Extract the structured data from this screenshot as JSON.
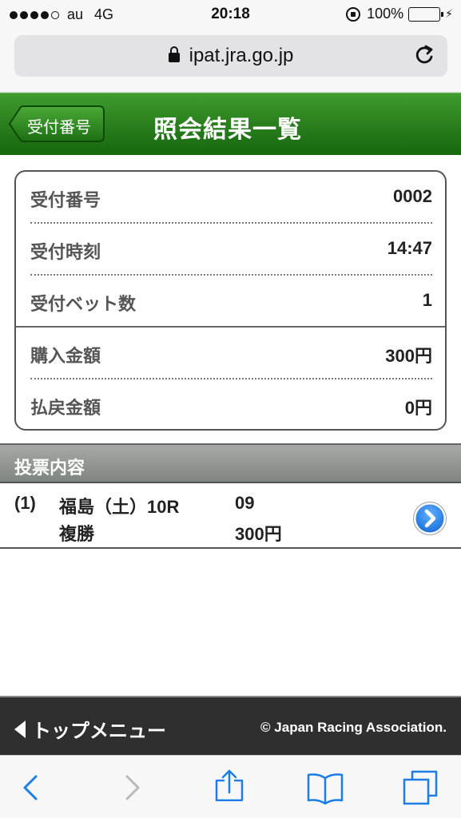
{
  "status_bar": {
    "carrier": "au",
    "network": "4G",
    "time": "20:18",
    "battery": "100%",
    "battery_level": 1.0,
    "signal_bars": 4,
    "signal_max": 5
  },
  "address_bar": {
    "url": "ipat.jra.go.jp"
  },
  "header": {
    "back_label": "受付番号",
    "title": "照会結果一覧"
  },
  "summary": {
    "rows": [
      {
        "label": "受付番号",
        "value": "0002"
      },
      {
        "label": "受付時刻",
        "value": "14:47"
      },
      {
        "label": "受付ベット数",
        "value": "1"
      },
      {
        "label": "購入金額",
        "value": "300円"
      },
      {
        "label": "払戻金額",
        "value": "0円"
      }
    ]
  },
  "votes": {
    "section_title": "投票内容",
    "items": [
      {
        "index": "(1)",
        "venue": "福島（土）10R",
        "bet_type": "複勝",
        "horse_number": "09",
        "amount": "300円"
      }
    ]
  },
  "footer": {
    "menu_label": "トップメニュー",
    "copyright": "© Japan Racing Association."
  },
  "colors": {
    "header_green": "#2a7f1d",
    "section_gray": "#8f958f",
    "footer_dark": "#2f2f2f",
    "link_blue": "#1a7ee6"
  },
  "icons": {
    "back": "chevron-left-icon",
    "forward": "chevron-right-icon",
    "share": "share-icon",
    "bookmarks": "book-icon",
    "tabs": "tabs-icon",
    "reload": "reload-icon",
    "detail": "circle-arrow-right-icon"
  }
}
